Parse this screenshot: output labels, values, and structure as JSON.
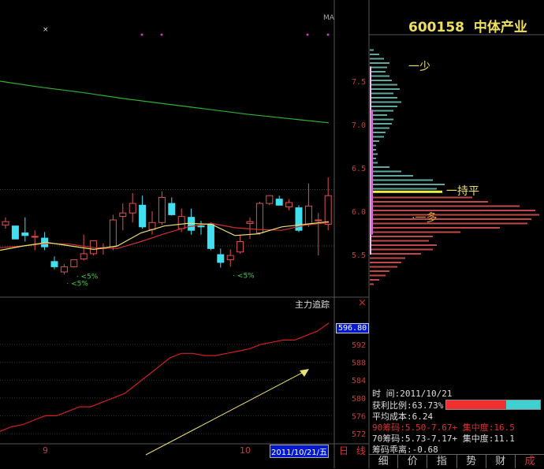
{
  "stock": {
    "code": "600158",
    "name": "中体产业"
  },
  "main_chart": {
    "ma_label": "MA",
    "price_axis": {
      "ticks": [
        7.5,
        7.0,
        6.5,
        6.0,
        5.5
      ],
      "labels": [
        "7.5",
        "7.0",
        "6.5",
        "6.0",
        "5.5"
      ],
      "range": [
        5.1,
        7.9
      ]
    },
    "candles": [
      [
        5.84,
        5.93,
        5.8,
        5.88
      ],
      [
        5.83,
        5.83,
        5.82,
        5.68
      ],
      [
        5.75,
        5.93,
        5.65,
        5.72
      ],
      [
        5.71,
        5.78,
        5.55,
        5.71
      ],
      [
        5.69,
        5.76,
        5.55,
        5.59
      ],
      [
        5.42,
        5.48,
        5.33,
        5.36
      ],
      [
        5.3,
        5.39,
        5.27,
        5.36
      ],
      [
        5.36,
        5.36,
        5.35,
        5.44
      ],
      [
        5.45,
        5.73,
        5.43,
        5.51
      ],
      [
        5.51,
        5.66,
        5.49,
        5.66
      ],
      [
        5.57,
        5.63,
        5.5,
        5.58
      ],
      [
        5.59,
        5.96,
        5.55,
        5.9
      ],
      [
        5.94,
        6.09,
        5.78,
        5.98
      ],
      [
        5.98,
        6.21,
        5.87,
        6.09
      ],
      [
        6.07,
        6.18,
        5.8,
        5.82
      ],
      [
        5.79,
        6.0,
        5.73,
        5.87
      ],
      [
        5.87,
        6.23,
        5.84,
        6.16
      ],
      [
        6.09,
        6.16,
        5.95,
        5.96
      ],
      [
        5.8,
        6.03,
        5.76,
        5.94
      ],
      [
        5.93,
        6.03,
        5.73,
        5.78
      ],
      [
        5.83,
        5.89,
        5.73,
        5.82
      ],
      [
        5.85,
        5.87,
        5.55,
        5.57
      ],
      [
        5.5,
        5.57,
        5.35,
        5.41
      ],
      [
        5.44,
        5.56,
        5.36,
        5.49
      ],
      [
        5.53,
        5.73,
        5.51,
        5.65
      ],
      [
        5.86,
        5.93,
        5.68,
        5.88
      ],
      [
        5.75,
        6.11,
        5.73,
        6.09
      ],
      [
        6.09,
        6.18,
        6.07,
        6.18
      ],
      [
        6.14,
        6.18,
        6.11,
        6.07
      ],
      [
        6.05,
        6.14,
        6.01,
        6.1
      ],
      [
        6.04,
        6.07,
        5.76,
        5.78
      ],
      [
        5.85,
        6.32,
        5.82,
        6.06
      ],
      [
        5.89,
        5.98,
        5.49,
        5.9
      ],
      [
        5.85,
        6.39,
        5.78,
        6.18
      ]
    ],
    "ma_long": [
      7.5,
      7.43,
      7.37,
      7.3,
      7.24,
      7.18,
      7.12,
      7.07,
      7.02
    ],
    "ma_yellow": [
      5.55,
      5.6,
      5.64,
      5.6,
      5.56,
      5.6,
      5.75,
      5.83,
      5.86,
      5.85,
      5.72,
      5.74,
      5.82,
      5.85,
      5.88
    ],
    "ma_red": [
      5.58,
      5.6,
      5.63,
      5.62,
      5.58,
      5.57,
      5.65,
      5.74,
      5.82,
      5.86,
      5.81,
      5.79,
      5.78,
      5.84,
      5.87
    ],
    "markers": [
      {
        "label": "<5%",
        "candle": 6
      },
      {
        "label": "<5%",
        "candle": 7
      },
      {
        "label": "<5%",
        "candle": 23
      }
    ],
    "top_marker": "×"
  },
  "indicator": {
    "title": "主力追踪",
    "close_icon": "×",
    "current_value": "596.80",
    "ticks": [
      "592",
      "588",
      "584",
      "580",
      "576",
      "572"
    ],
    "tick_values": [
      592,
      588,
      584,
      580,
      576,
      572
    ],
    "range": [
      570,
      598
    ],
    "series": [
      572.5,
      573.5,
      574,
      575,
      576,
      576,
      577,
      578,
      578,
      579,
      580,
      581,
      583,
      585,
      587,
      589,
      590,
      590,
      589.5,
      589.5,
      590,
      590.5,
      591,
      592,
      592.5,
      593,
      593,
      594,
      595,
      596.8
    ]
  },
  "time_axis": {
    "labels": [
      "9",
      "10"
    ],
    "current_date": "2011/10/21/五",
    "period": "日 线"
  },
  "chips": {
    "annotations": {
      "few": "一少",
      "flat": "一持平",
      "many": "·一多"
    },
    "flat_price": 6.22,
    "range_90": [
      5.5,
      7.67
    ],
    "range_70": [
      5.73,
      7.17
    ],
    "levels": [
      7.85,
      7.8,
      7.75,
      7.7,
      7.65,
      7.6,
      7.55,
      7.5,
      7.45,
      7.4,
      7.35,
      7.3,
      7.25,
      7.2,
      7.15,
      7.1,
      7.05,
      7.0,
      6.95,
      6.9,
      6.85,
      6.8,
      6.75,
      6.7,
      6.65,
      6.6,
      6.55,
      6.5,
      6.45,
      6.4,
      6.35,
      6.3,
      6.25,
      6.15,
      6.1,
      6.05,
      6.0,
      5.95,
      5.9,
      5.85,
      5.8,
      5.75,
      5.7,
      5.65,
      5.6,
      5.55,
      5.5,
      5.45,
      5.4,
      5.35,
      5.3,
      5.25,
      5.2,
      5.15
    ],
    "volumes": [
      5,
      12,
      18,
      25,
      22,
      20,
      25,
      28,
      35,
      38,
      30,
      35,
      40,
      35,
      30,
      22,
      30,
      28,
      25,
      20,
      18,
      12,
      8,
      8,
      10,
      8,
      10,
      25,
      40,
      55,
      80,
      95,
      85,
      130,
      150,
      190,
      210,
      215,
      205,
      200,
      165,
      115,
      80,
      75,
      85,
      80,
      65,
      45,
      40,
      35,
      25,
      20,
      12,
      5
    ],
    "colors": {
      "profit": "#5fa8a0",
      "loss": "#c04848",
      "flat": "#e8f040"
    }
  },
  "info": {
    "time_label": "时      间:2011/10/21",
    "profit_ratio_label": "获利比例:63.73%",
    "profit_ratio": 63.73,
    "avg_cost": "平均成本:6.24",
    "chip90": "90筹码:5.50-7.67+ 集中度:16.5",
    "chip70": "70筹码:5.73-7.17+ 集中度:11.1",
    "deviation": "筹码乖离:-0.68"
  },
  "tabs": [
    "细",
    "价",
    "指",
    "势",
    "财",
    "成"
  ],
  "colors": {
    "up": "#e05050",
    "down": "#40e0f0",
    "axis_text": "#c04040",
    "ma_long": "#30b030",
    "ma_yellow": "#e8e070",
    "ma_red": "#d03030"
  }
}
